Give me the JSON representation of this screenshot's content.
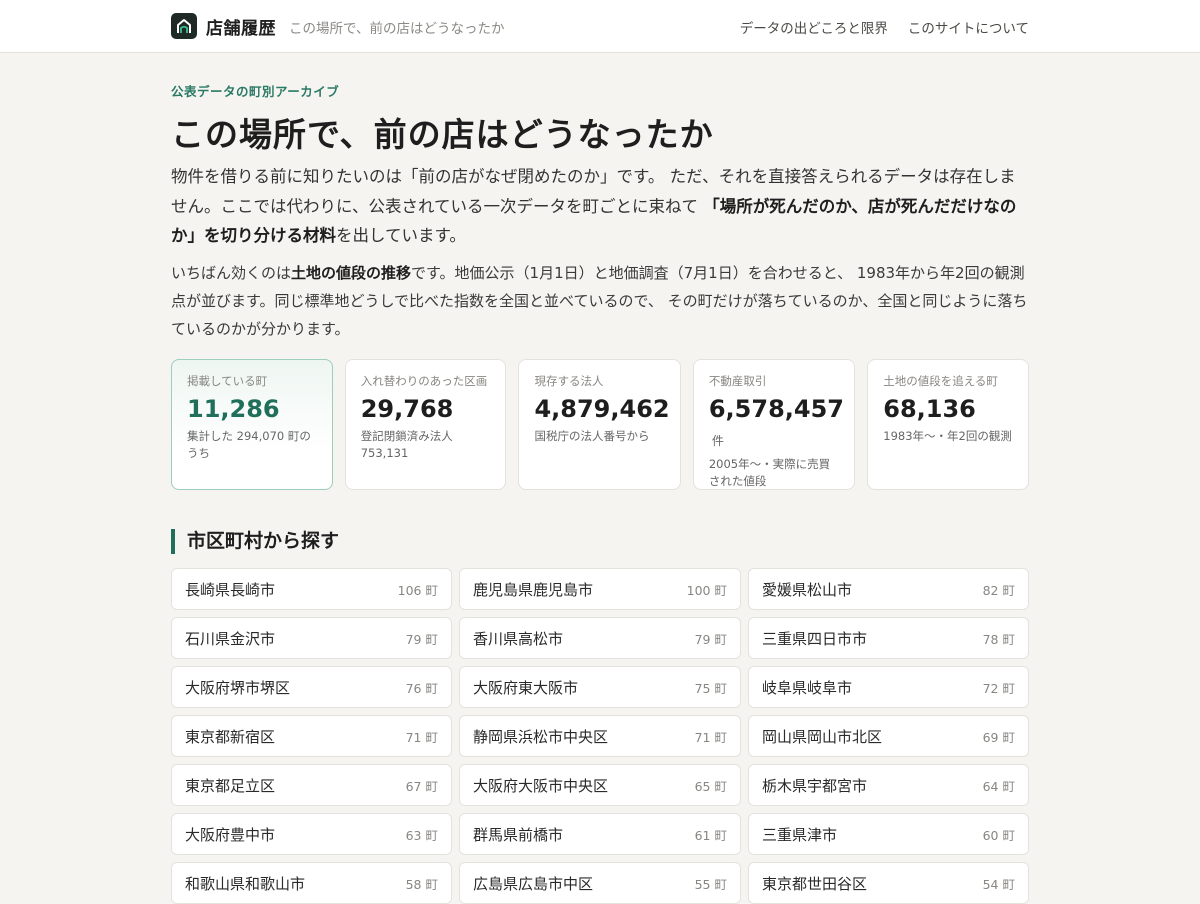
{
  "header": {
    "brand_name": "店舗履歴",
    "tagline": "この場所で、前の店はどうなったか",
    "nav": [
      "データの出どころと限界",
      "このサイトについて"
    ]
  },
  "hero": {
    "kicker": "公表データの町別アーカイブ",
    "title": "この場所で、前の店はどうなったか",
    "lead1_a": "物件を借りる前に知りたいのは「前の店がなぜ閉めたのか」です。 ただ、それを直接答えられるデータは存在しません。ここでは代わりに、公表されている一次データを町ごとに束ねて ",
    "lead1_strong": "「場所が死んだのか、店が死んだだけなのか」を切り分ける材料",
    "lead1_b": "を出しています。",
    "lead2_a": "いちばん効くのは",
    "lead2_strong": "土地の値段の推移",
    "lead2_b": "です。地価公示（1月1日）と地価調査（7月1日）を合わせると、 1983年から年2回の観測点が並びます。同じ標準地どうしで比べた指数を全国と並べているので、 その町だけが落ちているのか、全国と同じように落ちているのかが分かります。"
  },
  "stats": [
    {
      "label": "掲載している町",
      "value": "11,286",
      "unit": "",
      "note": "集計した 294,070 町のうち"
    },
    {
      "label": "入れ替わりのあった区画",
      "value": "29,768",
      "unit": "",
      "note": "登記閉鎖済み法人 753,131"
    },
    {
      "label": "現存する法人",
      "value": "4,879,462",
      "unit": "",
      "note": "国税庁の法人番号から"
    },
    {
      "label": "不動産取引",
      "value": "6,578,457",
      "unit": "件",
      "note": "2005年〜・実際に売買された値段"
    },
    {
      "label": "土地の値段を追える町",
      "value": "68,136",
      "unit": "",
      "note": "1983年〜・年2回の観測"
    }
  ],
  "section": {
    "title": "市区町村から探す"
  },
  "cities": [
    {
      "name": "長崎県長崎市",
      "count": "106 町"
    },
    {
      "name": "鹿児島県鹿児島市",
      "count": "100 町"
    },
    {
      "name": "愛媛県松山市",
      "count": "82 町"
    },
    {
      "name": "石川県金沢市",
      "count": "79 町"
    },
    {
      "name": "香川県高松市",
      "count": "79 町"
    },
    {
      "name": "三重県四日市市",
      "count": "78 町"
    },
    {
      "name": "大阪府堺市堺区",
      "count": "76 町"
    },
    {
      "name": "大阪府東大阪市",
      "count": "75 町"
    },
    {
      "name": "岐阜県岐阜市",
      "count": "72 町"
    },
    {
      "name": "東京都新宿区",
      "count": "71 町"
    },
    {
      "name": "静岡県浜松市中央区",
      "count": "71 町"
    },
    {
      "name": "岡山県岡山市北区",
      "count": "69 町"
    },
    {
      "name": "東京都足立区",
      "count": "67 町"
    },
    {
      "name": "大阪府大阪市中央区",
      "count": "65 町"
    },
    {
      "name": "栃木県宇都宮市",
      "count": "64 町"
    },
    {
      "name": "大阪府豊中市",
      "count": "63 町"
    },
    {
      "name": "群馬県前橋市",
      "count": "61 町"
    },
    {
      "name": "三重県津市",
      "count": "60 町"
    },
    {
      "name": "和歌山県和歌山市",
      "count": "58 町"
    },
    {
      "name": "広島県広島市中区",
      "count": "55 町"
    },
    {
      "name": "東京都世田谷区",
      "count": "54 町"
    }
  ],
  "colors": {
    "accent": "#1f6f5b",
    "kicker": "#2b7a66",
    "background": "#f5f4f1",
    "card_border": "#e4e2dd"
  },
  "icons": {
    "logo": "storefront-logo-icon"
  }
}
